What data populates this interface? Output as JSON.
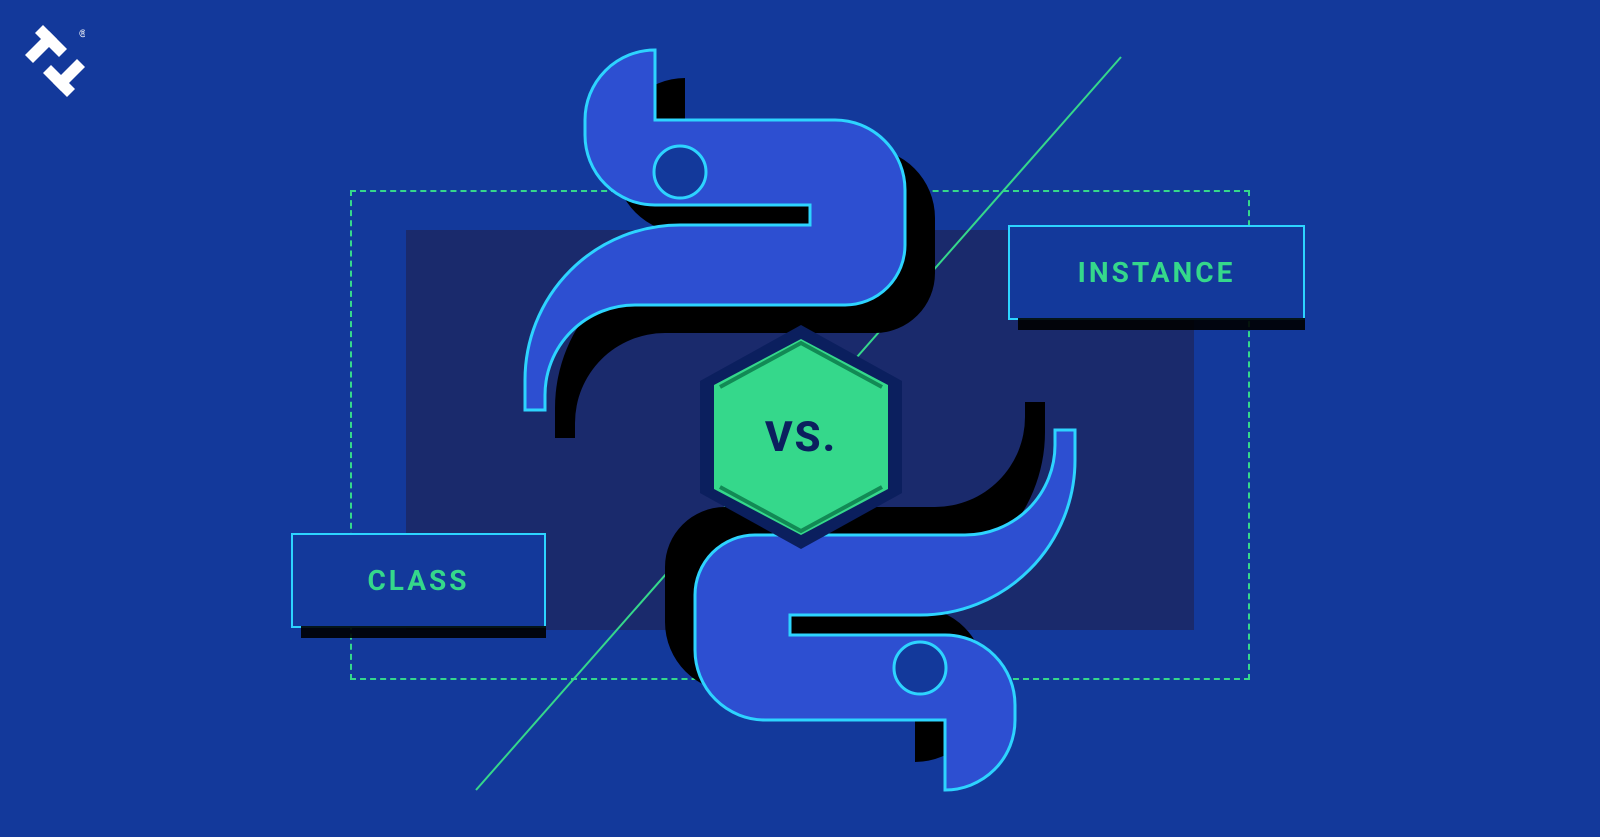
{
  "brand": {
    "name": "Toptal"
  },
  "badge": {
    "text": "VS."
  },
  "labels": {
    "left": "CLASS",
    "right": "INSTANCE"
  },
  "colors": {
    "background": "#13399b",
    "accent_green": "#35d88b",
    "accent_cyan": "#2dd4ff",
    "dark_panel": "#1a2a6c",
    "snake_blue": "#2d4fd1",
    "shadow": "#000000"
  },
  "icon": {
    "name": "python-logo"
  }
}
